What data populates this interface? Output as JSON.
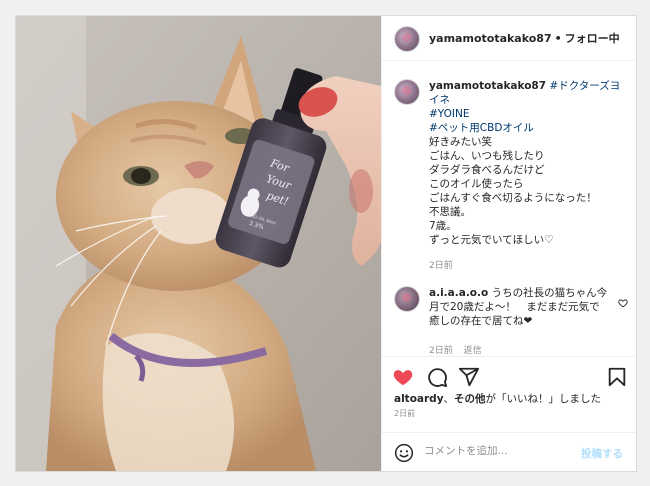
{
  "post": {
    "username": "yamamototakako87",
    "separator": "•",
    "follow_label": "フォロー中",
    "photo": {
      "bottle_label_line1": "For",
      "bottle_label_line2": "Your",
      "bottle_label_line3": "pet!",
      "bottle_label_small": "CBD OIL 30ml",
      "bottle_label_pct": "3.3%"
    }
  },
  "caption": {
    "username": "yamamototakako87",
    "hashtag1": "#ドクターズヨイネ",
    "hashtag2": "#YOINE",
    "hashtag3": "#ペット用CBDオイル",
    "body": "好きみたい笑\nごはん、いつも残したり\nダラダラ食べるんだけど\nこのオイル使ったら\nごはんすぐ食べ切るようになった！\n不思議。\n7歳。\nずっと元気でいてほしい♡",
    "time": "2日前"
  },
  "comment": {
    "username": "a.i.a.a.o.o",
    "text": "うちの社長の猫ちゃん今月で20歳だよ～！　まだまだ元気で癒しの存在で居てね❤",
    "time": "2日前",
    "reply_label": "返信"
  },
  "likes": {
    "user": "altoardy",
    "joiner": "、",
    "others": "その他",
    "suffix": "が「いいね！」しました"
  },
  "post_time": "2日前",
  "add_comment": {
    "placeholder": "コメントを追加...",
    "post_label": "投稿する"
  },
  "colors": {
    "like_red": "#ed4956",
    "link": "#00376b",
    "muted": "#8e8e8e",
    "post_button_disabled": "#b2dffc"
  },
  "icons": {
    "like": "heart-filled-icon",
    "comment": "speech-bubble-icon",
    "share": "paper-plane-icon",
    "save": "bookmark-icon",
    "emoji": "smiley-icon",
    "comment_like": "heart-outline-icon"
  }
}
